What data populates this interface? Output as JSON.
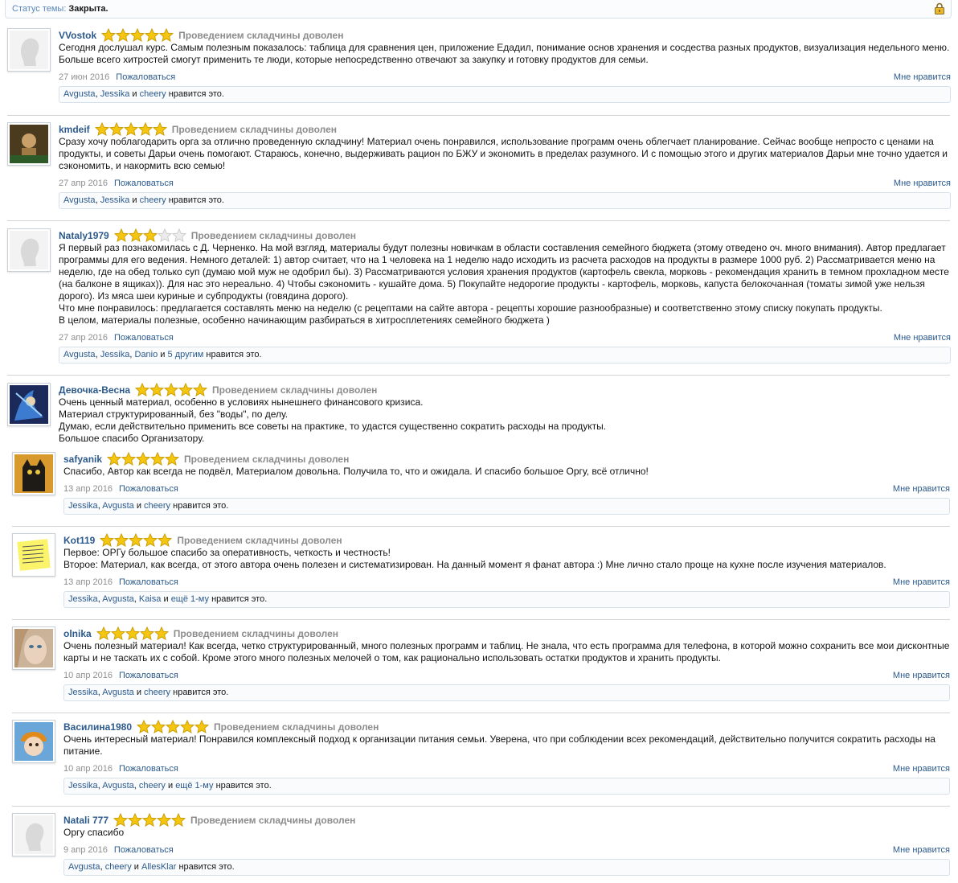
{
  "status": {
    "label": "Статус темы:",
    "value": "Закрыта."
  },
  "verdict": "Проведением складчины доволен",
  "report_label": "Пожаловаться",
  "like_label": "Мне нравится",
  "likes_suffix": "нравится это.",
  "posts": [
    {
      "author": "VVostok",
      "avatar": "default-avatar",
      "stars": 5,
      "date": "27 июн 2016",
      "lines": [
        "Сегодня дослушал курс. Самым полезным показалось: таблица для сравнения цен, приложение Едадил, понимание основ хранения и сосдества разных продуктов, визуализация недельного меню. Больше всего хитростей смогут применить те люди, которые непосредственно отвечают за закупку и готовку продуктов для семьи."
      ],
      "likes": {
        "users": [
          "Avgusta",
          "Jessika",
          "cheery"
        ],
        "more": ""
      }
    },
    {
      "author": "kmdeif",
      "avatar": "photo-avatar",
      "stars": 5,
      "date": "27 апр 2016",
      "lines": [
        "Сразу хочу поблагодарить орга за отлично проведенную складчину! Материал очень понравился, использование программ очень облегчает планирование. Сейчас вообще непросто с ценами на продукты, и советы Дарьи очень помогают. Стараюсь, конечно, выдерживать рацион по БЖУ и экономить в пределах разумного. И с помощью этого и других материалов Дарьи мне точно удается и сэкономить, и накормить всю семью!"
      ],
      "likes": {
        "users": [
          "Avgusta",
          "Jessika",
          "cheery"
        ],
        "more": ""
      }
    },
    {
      "author": "Nataly1979",
      "avatar": "default-avatar",
      "stars": 3,
      "date": "27 апр 2016",
      "lines": [
        "Я первый раз познакомилась с Д. Черненко. На мой взгляд, материалы будут полезны новичкам в области составления семейного бюджета (этому отведено оч. много внимания). Автор предлагает программы для его ведения. Немного деталей: 1) автор считает, что на 1 человека на 1 неделю надо исходить из расчета расходов на продукты в размере 1000 руб. 2) Рассматривается меню на неделю, где на обед только суп (думаю мой муж не одобрил бы). 3) Рассматриваются условия хранения продуктов (картофель свекла, морковь - рекомендация хранить в темном прохладном месте (на балконе в ящиках)). Для нас это нереально. 4) Чтобы сэкономить - кушайте дома. 5) Покупайте недорогие продукты - картофель, морковь, капуста белокочанная (томаты зимой уже нельзя дорого). Из мяса шеи куриные и субпродукты (говядина дорого).",
        "Что мне понравилось: предлагается составлять меню на неделю (с рецептами на сайте автора - рецепты хорошие разнообразные) и соответственно этому списку покупать продукты.",
        "В целом, материалы полезные, особенно начинающим разбираться в хитросплетениях семейного бюджета )"
      ],
      "likes": {
        "users": [
          "Avgusta",
          "Jessika",
          "Danio"
        ],
        "more": "5 другим"
      }
    },
    {
      "author": "Девочка-Весна",
      "avatar": "fantasy-avatar",
      "stars": 5,
      "date": "",
      "lines": [
        "Очень ценный материал, особенно в условиях нынешнего финансового кризиса.",
        "Материал структурированный, без \"воды\", по делу.",
        "Думаю, если действительно применить все советы на практике, то удастся существенно сократить расходы на продукты.",
        "Большое спасибо Организатору."
      ],
      "likes": null
    },
    {
      "author": "safyanik",
      "avatar": "cat-avatar",
      "stars": 5,
      "date": "13 апр 2016",
      "lines": [
        "Спасибо, Автор как всегда не подвёл, Материалом довольна. Получила то, что и ожидала. И спасибо большое Оргу, всё отлично!"
      ],
      "likes": {
        "users": [
          "Jessika",
          "Avgusta",
          "cheery"
        ],
        "more": ""
      }
    },
    {
      "author": "Kot119",
      "avatar": "note-avatar",
      "stars": 5,
      "date": "13 апр 2016",
      "lines": [
        "Первое: ОРГу большое спасибо за оперативность, четкость и честность!",
        "Второе: Материал, как всегда, от этого автора очень полезен и систематизирован. На данный момент я фанат автора :) Мне лично стало проще на кухне после изучения материалов."
      ],
      "likes": {
        "users": [
          "Jessika",
          "Avgusta",
          "Kaisa"
        ],
        "more": "ещё 1-му"
      }
    },
    {
      "author": "olnika",
      "avatar": "face-avatar",
      "stars": 5,
      "date": "10 апр 2016",
      "lines": [
        "Очень полезный материал! Как всегда, четко структурированный, много полезных программ и таблиц. Не знала, что есть программа для телефона, в которой можно сохранить все мои дисконтные карты и не таскать их с собой. Кроме этого много полезных мелочей о том, как рационально использовать остатки продуктов и хранить продукты."
      ],
      "likes": {
        "users": [
          "Jessika",
          "Avgusta",
          "cheery"
        ],
        "more": ""
      }
    },
    {
      "author": "Василина1980",
      "avatar": "doll-avatar",
      "stars": 5,
      "date": "10 апр 2016",
      "lines": [
        "Очень интересный материал! Понравился комплексный подход к организации питания семьи. Уверена, что при соблюдении всех рекомендаций, действительно получится сократить расходы на питание."
      ],
      "likes": {
        "users": [
          "Jessika",
          "Avgusta",
          "cheery"
        ],
        "more": "ещё 1-му"
      }
    },
    {
      "author": "Natali 777",
      "avatar": "default-avatar",
      "stars": 5,
      "date": "9 апр 2016",
      "lines": [
        "Оргу спасибо"
      ],
      "likes": {
        "users": [
          "Avgusta",
          "cheery",
          "AllesKlar"
        ],
        "more": ""
      }
    }
  ],
  "colors": {
    "link": "#2c5a8c",
    "muted": "#8f8f8f",
    "star": "#f2c200",
    "border": "#d7e1ec"
  }
}
